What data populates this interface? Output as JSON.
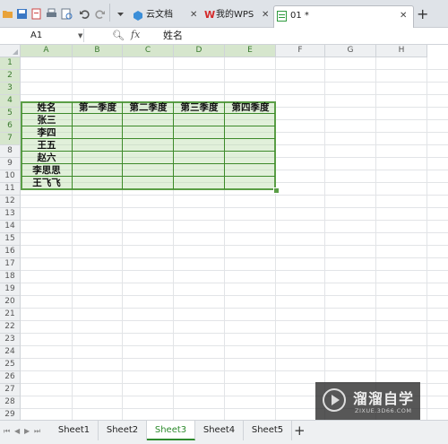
{
  "tabs": [
    {
      "label": "云文档",
      "icon": "cloud-cube-icon"
    },
    {
      "label": "我的WPS",
      "icon": "wps-logo-icon"
    },
    {
      "label": "01 *",
      "icon": "spreadsheet-file-icon",
      "active": true
    }
  ],
  "name_box": "A1",
  "formula": "姓名",
  "columns": [
    "A",
    "B",
    "C",
    "D",
    "E",
    "F",
    "G",
    "H"
  ],
  "rows": [
    "1",
    "2",
    "3",
    "4",
    "5",
    "6",
    "7",
    "8",
    "9",
    "10",
    "11",
    "12",
    "13",
    "14",
    "15",
    "16",
    "17",
    "18",
    "19",
    "20",
    "21",
    "22",
    "23",
    "24",
    "25",
    "26",
    "27",
    "28",
    "29"
  ],
  "cells": {
    "header": [
      "姓名",
      "第一季度",
      "第二季度",
      "第三季度",
      "第四季度"
    ],
    "names": [
      "张三",
      "李四",
      "王五",
      "赵六",
      "李思思",
      "王飞飞"
    ]
  },
  "sheets": [
    {
      "label": "Sheet1"
    },
    {
      "label": "Sheet2"
    },
    {
      "label": "Sheet3",
      "active": true
    },
    {
      "label": "Sheet4"
    },
    {
      "label": "Sheet5"
    }
  ],
  "add_sheet": "+",
  "watermark": {
    "title": "溜溜自学",
    "subtitle": "ZIXUE.3D66.COM"
  },
  "colors": {
    "accent": "#5a9e46",
    "active_sheet": "#2e8b2e",
    "selection_fill": "#bcdeac"
  }
}
